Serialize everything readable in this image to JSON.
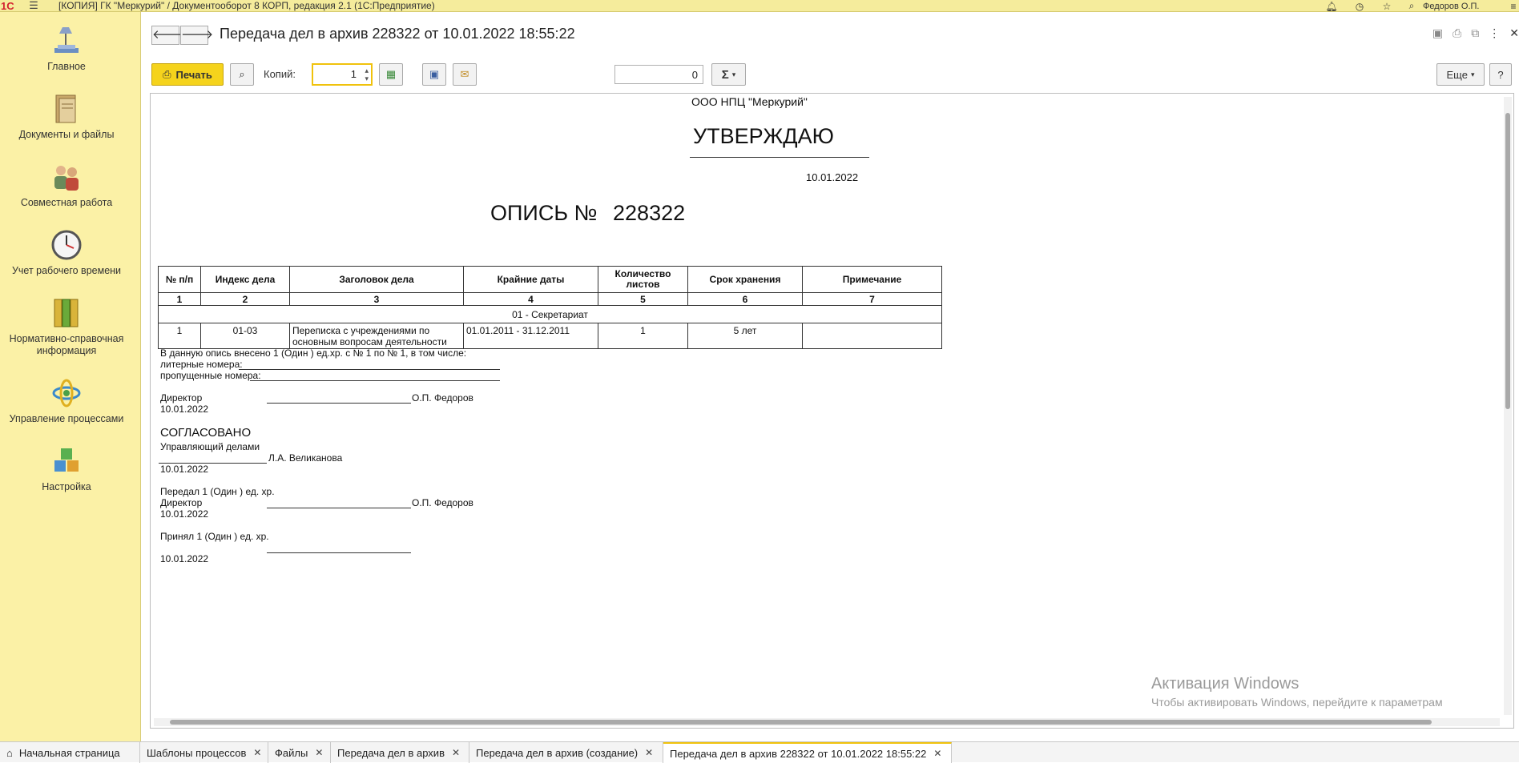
{
  "titlebar": {
    "logo": "1С",
    "title": "[КОПИЯ] ГК \"Меркурий\" / Документооборот 8 КОРП, редакция 2.1  (1С:Предприятие)",
    "user": "Федоров О.П."
  },
  "sidebar": {
    "items": [
      {
        "label": "Главное",
        "icon": "desk-lamp-icon"
      },
      {
        "label": "Документы и файлы",
        "icon": "documents-icon"
      },
      {
        "label": "Совместная работа",
        "icon": "people-icon"
      },
      {
        "label": "Учет рабочего времени",
        "icon": "clock-icon"
      },
      {
        "label": "Нормативно-справочная информация",
        "icon": "binders-icon"
      },
      {
        "label": "Управление процессами",
        "icon": "process-icon"
      },
      {
        "label": "Настройка",
        "icon": "cubes-icon"
      }
    ]
  },
  "form": {
    "title": "Передача дел в архив 228322 от 10.01.2022 18:55:22"
  },
  "toolbar": {
    "print_label": "Печать",
    "copies_label": "Копий:",
    "copies_value": "1",
    "sum_value": "0",
    "sum_symbol": "Σ",
    "more_label": "Еще",
    "help_label": "?"
  },
  "doc": {
    "org": "ООО НПЦ \"Меркурий\"",
    "approve": "УТВЕРЖДАЮ",
    "approve_date": "10.01.2022",
    "inventory_title": "ОПИСЬ №",
    "inventory_number": "228322",
    "table": {
      "headers": [
        "№ п/п",
        "Индекс дела",
        "Заголовок дела",
        "Крайние даты",
        "Количество листов",
        "Срок хранения",
        "Примечание"
      ],
      "numbers": [
        "1",
        "2",
        "3",
        "4",
        "5",
        "6",
        "7"
      ],
      "group": "01 - Секретариат",
      "rows": [
        [
          "1",
          "01-03",
          "Переписка с учреждениями по основным вопросам деятельности",
          "01.01.2011 - 31.12.2011",
          "1",
          "5 лет",
          ""
        ]
      ]
    },
    "summary_line": "В данную опись внесено 1 (Один ) ед.хр. с № 1 по № 1, в том числе:",
    "letter_numbers": "литерные номера:",
    "skipped_numbers": "пропущенные номера:",
    "director_label": "Директор",
    "director_name": "О.П. Федоров",
    "director_date": "10.01.2022",
    "agreed": "СОГЛАСОВАНО",
    "manager_label": "Управляющий делами",
    "manager_name": "Л.А. Великанова",
    "manager_date": "10.01.2022",
    "handed": "Передал 1 (Один ) ед. хр.",
    "handed_role": "Директор",
    "handed_name": "О.П. Федоров",
    "handed_date": "10.01.2022",
    "received": "Принял 1 (Один ) ед. хр.",
    "received_date": "10.01.2022"
  },
  "watermark": {
    "title": "Активация Windows",
    "sub": "Чтобы активировать Windows, перейдите к параметрам"
  },
  "tabs": [
    {
      "label": "Начальная страница"
    },
    {
      "label": "Шаблоны процессов"
    },
    {
      "label": "Файлы"
    },
    {
      "label": "Передача дел в архив"
    },
    {
      "label": "Передача дел в архив (создание)"
    },
    {
      "label": "Передача дел в архив 228322 от 10.01.2022 18:55:22"
    }
  ]
}
